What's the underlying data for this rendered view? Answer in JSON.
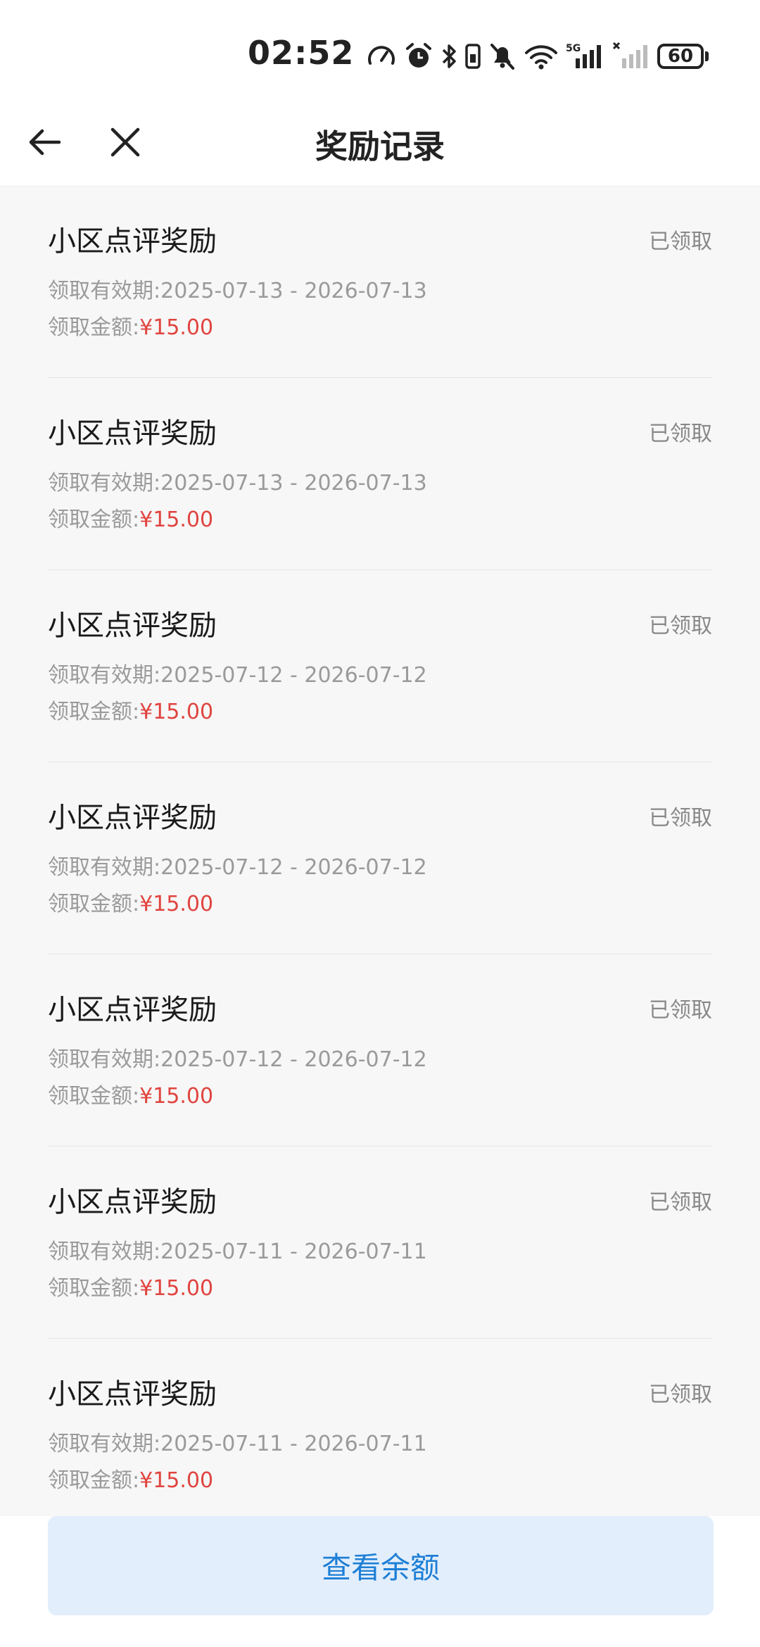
{
  "status_bar": {
    "time": "02:52",
    "icons": [
      "speedometer-icon",
      "alarm-icon",
      "bluetooth-icon",
      "vibrate-icon",
      "mute-bell-icon",
      "wifi-icon",
      "signal-5g-icon",
      "signal-no-service-icon"
    ],
    "network_label": "5G",
    "battery_level": "60"
  },
  "nav": {
    "title": "奖励记录"
  },
  "records": [
    {
      "title": "小区点评奖励",
      "status": "已领取",
      "validity_label": "领取有效期:",
      "validity": "2025-07-13 - 2026-07-13",
      "amount_label": "领取金额:",
      "amount": "¥15.00"
    },
    {
      "title": "小区点评奖励",
      "status": "已领取",
      "validity_label": "领取有效期:",
      "validity": "2025-07-13 - 2026-07-13",
      "amount_label": "领取金额:",
      "amount": "¥15.00"
    },
    {
      "title": "小区点评奖励",
      "status": "已领取",
      "validity_label": "领取有效期:",
      "validity": "2025-07-12 - 2026-07-12",
      "amount_label": "领取金额:",
      "amount": "¥15.00"
    },
    {
      "title": "小区点评奖励",
      "status": "已领取",
      "validity_label": "领取有效期:",
      "validity": "2025-07-12 - 2026-07-12",
      "amount_label": "领取金额:",
      "amount": "¥15.00"
    },
    {
      "title": "小区点评奖励",
      "status": "已领取",
      "validity_label": "领取有效期:",
      "validity": "2025-07-12 - 2026-07-12",
      "amount_label": "领取金额:",
      "amount": "¥15.00"
    },
    {
      "title": "小区点评奖励",
      "status": "已领取",
      "validity_label": "领取有效期:",
      "validity": "2025-07-11 - 2026-07-11",
      "amount_label": "领取金额:",
      "amount": "¥15.00"
    },
    {
      "title": "小区点评奖励",
      "status": "已领取",
      "validity_label": "领取有效期:",
      "validity": "2025-07-11 - 2026-07-11",
      "amount_label": "领取金额:",
      "amount": "¥15.00"
    }
  ],
  "bottom": {
    "balance_button_label": "查看余额"
  },
  "colors": {
    "amount": "#e0443f",
    "button_bg": "#e2eefb",
    "button_text": "#1e7fd6"
  }
}
